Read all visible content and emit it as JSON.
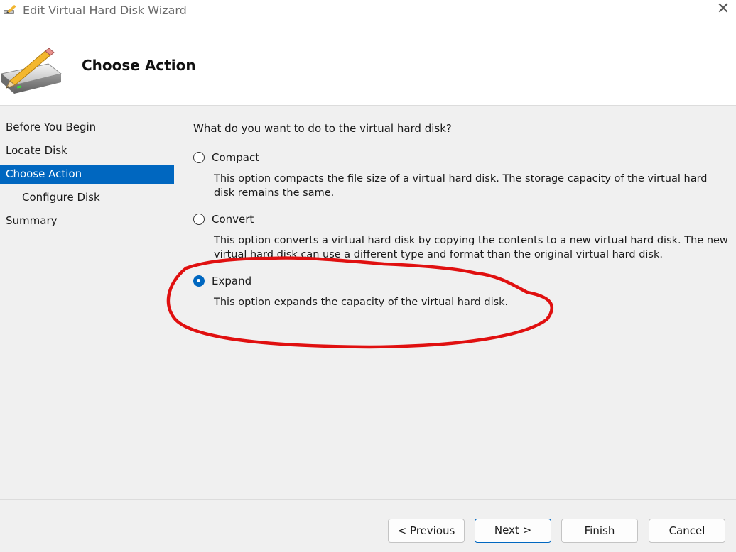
{
  "window": {
    "title": "Edit Virtual Hard Disk Wizard",
    "close_symbol": "✕"
  },
  "header": {
    "title": "Choose Action",
    "icon": "hard-disk-edit-icon"
  },
  "nav": {
    "items": [
      {
        "label": "Before You Begin",
        "active": false,
        "sub": false
      },
      {
        "label": "Locate Disk",
        "active": false,
        "sub": false
      },
      {
        "label": "Choose Action",
        "active": true,
        "sub": false
      },
      {
        "label": "Configure Disk",
        "active": false,
        "sub": true
      },
      {
        "label": "Summary",
        "active": false,
        "sub": false
      }
    ]
  },
  "content": {
    "question": "What do you want to do to the virtual hard disk?",
    "options": [
      {
        "label": "Compact",
        "description": "This option compacts the file size of a virtual hard disk. The storage capacity of the virtual hard disk remains the same.",
        "checked": false
      },
      {
        "label": "Convert",
        "description": "This option converts a virtual hard disk by copying the contents to a new virtual hard disk. The new virtual hard disk can use a different type and format than the original virtual hard disk.",
        "checked": false
      },
      {
        "label": "Expand",
        "description": "This option expands the capacity of the virtual hard disk.",
        "checked": true
      }
    ]
  },
  "footer": {
    "previous_label": "< Previous",
    "next_label": "Next >",
    "finish_label": "Finish",
    "cancel_label": "Cancel"
  },
  "colors": {
    "accent": "#0067c0",
    "annotation": "#e01010"
  }
}
